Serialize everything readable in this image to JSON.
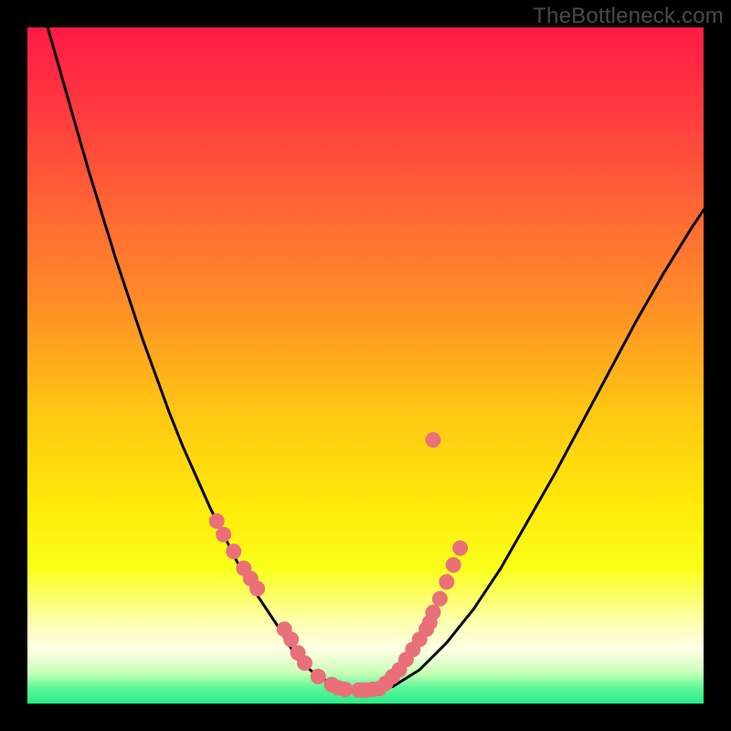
{
  "watermark": "TheBottleneck.com",
  "colors": {
    "frame": "#000000",
    "curve": "#000000",
    "dots": "#e97079",
    "green_band": "#26ec8a",
    "gradient_stops": [
      {
        "offset": 0.0,
        "color": "#ff1a45"
      },
      {
        "offset": 0.13,
        "color": "#ff3c3f"
      },
      {
        "offset": 0.28,
        "color": "#ff6a33"
      },
      {
        "offset": 0.42,
        "color": "#ff9126"
      },
      {
        "offset": 0.56,
        "color": "#ffc414"
      },
      {
        "offset": 0.7,
        "color": "#ffe80a"
      },
      {
        "offset": 0.8,
        "color": "#f9ff19"
      },
      {
        "offset": 0.88,
        "color": "#fdffb0"
      },
      {
        "offset": 0.92,
        "color": "#ffffe6"
      },
      {
        "offset": 0.955,
        "color": "#c7ffb8"
      },
      {
        "offset": 0.975,
        "color": "#63f89a"
      },
      {
        "offset": 1.0,
        "color": "#26ec8a"
      }
    ]
  },
  "chart_data": {
    "type": "line",
    "title": "",
    "xlabel": "",
    "ylabel": "",
    "xlim": [
      0,
      100
    ],
    "ylim": [
      0,
      100
    ],
    "series": [
      {
        "name": "bottleneck-curve",
        "x": [
          3,
          5,
          7,
          9,
          11,
          13,
          15,
          17,
          19,
          21,
          23,
          25,
          27,
          29,
          31,
          33,
          35,
          37,
          38.5,
          40,
          43,
          46,
          50,
          54,
          58,
          62,
          66,
          70,
          74,
          78,
          82,
          86,
          90,
          94,
          98,
          100
        ],
        "y": [
          100,
          93,
          86,
          79,
          72.5,
          66,
          60,
          54,
          48.5,
          43,
          38,
          33.5,
          29,
          25,
          21,
          17.5,
          14.5,
          11.5,
          9,
          6.5,
          4,
          2.5,
          2,
          2.5,
          5,
          9,
          14,
          20,
          27,
          34,
          41.5,
          49,
          56.5,
          63.5,
          70,
          73
        ]
      }
    ],
    "points": [
      {
        "name": "scatter-left-branch",
        "x": [
          28,
          29,
          30.5,
          32,
          33,
          34,
          38,
          39,
          40,
          41,
          43,
          45,
          46,
          47,
          49,
          49.5,
          50,
          51,
          52
        ],
        "y": [
          27,
          25,
          22.5,
          20,
          18.5,
          17,
          11,
          9.5,
          7.5,
          6,
          4,
          2.8,
          2.3,
          2.1,
          2,
          2,
          2,
          2.1,
          2.2
        ]
      },
      {
        "name": "scatter-right-branch",
        "x": [
          53,
          54,
          55,
          56,
          57,
          58,
          59,
          59.5,
          60,
          61,
          62,
          63,
          64
        ],
        "y": [
          3,
          4,
          5,
          6.5,
          8,
          9.5,
          11,
          12,
          13.5,
          15.5,
          18,
          20.5,
          23
        ]
      },
      {
        "name": "scatter-outlier",
        "x": [
          60
        ],
        "y": [
          39
        ]
      }
    ]
  }
}
